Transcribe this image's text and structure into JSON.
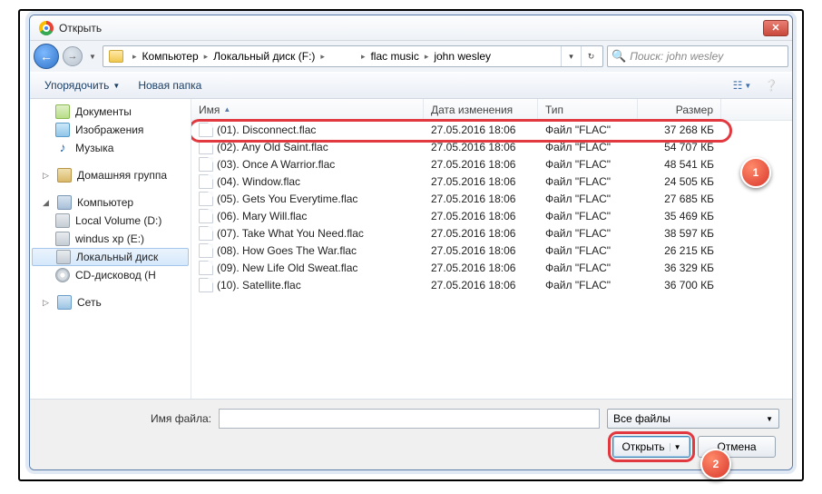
{
  "titlebar": {
    "title": "Открыть"
  },
  "breadcrumb": {
    "segments": [
      "Компьютер",
      "Локальный диск (F:)",
      "",
      "flac music",
      "john wesley"
    ]
  },
  "search": {
    "placeholder": "Поиск: john wesley"
  },
  "toolbar": {
    "organize": "Упорядочить",
    "newfolder": "Новая папка"
  },
  "sidebar": {
    "docs": "Документы",
    "images": "Изображения",
    "music": "Музыка",
    "homegroup": "Домашняя группа",
    "computer": "Компьютер",
    "vol_d": "Local Volume (D:)",
    "vol_e": "windus xp (E:)",
    "vol_f": "Локальный диск",
    "cd": "CD-дисковод (H",
    "network": "Сеть"
  },
  "columns": {
    "name": "Имя",
    "date": "Дата изменения",
    "type": "Тип",
    "size": "Размер"
  },
  "files": [
    {
      "name": "(01). Disconnect.flac",
      "date": "27.05.2016 18:06",
      "type": "Файл \"FLAC\"",
      "size": "37 268 КБ"
    },
    {
      "name": "(02). Any Old Saint.flac",
      "date": "27.05.2016 18:06",
      "type": "Файл \"FLAC\"",
      "size": "54 707 КБ"
    },
    {
      "name": "(03). Once A Warrior.flac",
      "date": "27.05.2016 18:06",
      "type": "Файл \"FLAC\"",
      "size": "48 541 КБ"
    },
    {
      "name": "(04). Window.flac",
      "date": "27.05.2016 18:06",
      "type": "Файл \"FLAC\"",
      "size": "24 505 КБ"
    },
    {
      "name": "(05). Gets You Everytime.flac",
      "date": "27.05.2016 18:06",
      "type": "Файл \"FLAC\"",
      "size": "27 685 КБ"
    },
    {
      "name": "(06). Mary Will.flac",
      "date": "27.05.2016 18:06",
      "type": "Файл \"FLAC\"",
      "size": "35 469 КБ"
    },
    {
      "name": "(07). Take What You Need.flac",
      "date": "27.05.2016 18:06",
      "type": "Файл \"FLAC\"",
      "size": "38 597 КБ"
    },
    {
      "name": "(08). How Goes The War.flac",
      "date": "27.05.2016 18:06",
      "type": "Файл \"FLAC\"",
      "size": "26 215 КБ"
    },
    {
      "name": "(09). New Life Old Sweat.flac",
      "date": "27.05.2016 18:06",
      "type": "Файл \"FLAC\"",
      "size": "36 329 КБ"
    },
    {
      "name": "(10). Satellite.flac",
      "date": "27.05.2016 18:06",
      "type": "Файл \"FLAC\"",
      "size": "36 700 КБ"
    }
  ],
  "bottom": {
    "filename_label": "Имя файла:",
    "filter": "Все файлы",
    "open": "Открыть",
    "cancel": "Отмена"
  },
  "callouts": {
    "one": "1",
    "two": "2"
  }
}
